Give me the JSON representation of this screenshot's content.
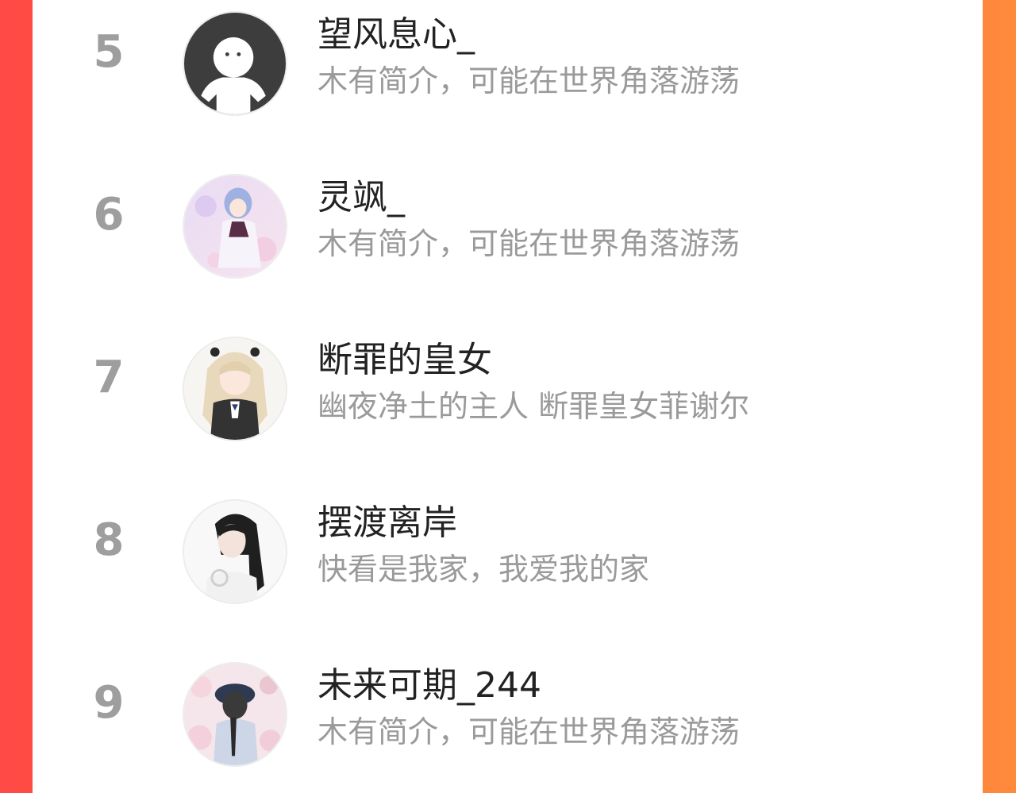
{
  "colors": {
    "background_left": "#ff4a45",
    "background_right": "#ff8a3c",
    "panel": "#ffffff",
    "rank_text": "#9e9e9e",
    "name_text": "#222222",
    "bio_text": "#9a9a9a"
  },
  "ranking": {
    "items": [
      {
        "rank": "5",
        "name": "望风息心_",
        "bio": "木有简介，可能在世界角落游荡",
        "avatar": "default-avatar-icon"
      },
      {
        "rank": "6",
        "name": "灵飒_",
        "bio": "木有简介，可能在世界角落游荡",
        "avatar": "anime-girl-avatar"
      },
      {
        "rank": "7",
        "name": "断罪的皇女",
        "bio": "幽夜净土的主人 断罪皇女菲谢尔",
        "avatar": "anime-blonde-girl-avatar"
      },
      {
        "rank": "8",
        "name": "摆渡离岸",
        "bio": "快看是我家，我爱我的家",
        "avatar": "dark-hair-girl-avatar"
      },
      {
        "rank": "9",
        "name": "未来可期_244",
        "bio": "木有简介，可能在世界角落游荡",
        "avatar": "girl-with-hat-avatar"
      }
    ]
  }
}
